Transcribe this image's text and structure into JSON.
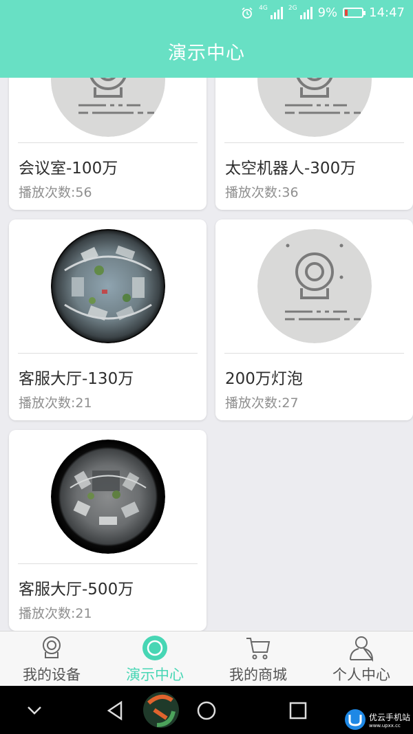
{
  "status_bar": {
    "time": "14:47",
    "battery": "9%",
    "network_1": "4G",
    "network_2": "2G",
    "icons": [
      "alarm-icon",
      "signal-icon",
      "signal-icon",
      "battery-icon"
    ]
  },
  "header": {
    "title": "演示中心"
  },
  "cameras": [
    {
      "name": "会议室-100万",
      "plays_label": "播放次数:56",
      "thumbnail": "camera-placeholder-icon"
    },
    {
      "name": "太空机器人-300万",
      "plays_label": "播放次数:36",
      "thumbnail": "camera-placeholder-icon"
    },
    {
      "name": "客服大厅-130万",
      "plays_label": "播放次数:21",
      "thumbnail": "fisheye-preview"
    },
    {
      "name": "200万灯泡",
      "plays_label": "播放次数:27",
      "thumbnail": "camera-placeholder-icon"
    },
    {
      "name": "客服大厅-500万",
      "plays_label": "播放次数:21",
      "thumbnail": "fisheye-preview"
    }
  ],
  "tabbar": {
    "active_index": 1,
    "accent": "#47d6b4",
    "tabs": [
      {
        "label": "我的设备",
        "icon": "camera-icon"
      },
      {
        "label": "演示中心",
        "icon": "demo-circle-icon"
      },
      {
        "label": "我的商城",
        "icon": "cart-icon"
      },
      {
        "label": "个人中心",
        "icon": "person-icon"
      }
    ]
  },
  "watermark": {
    "text": "优云手机站",
    "url": "www.upxx.cc"
  },
  "colors": {
    "header": "#68e0c4",
    "accent": "#47d6b4",
    "background": "#ececf0"
  }
}
